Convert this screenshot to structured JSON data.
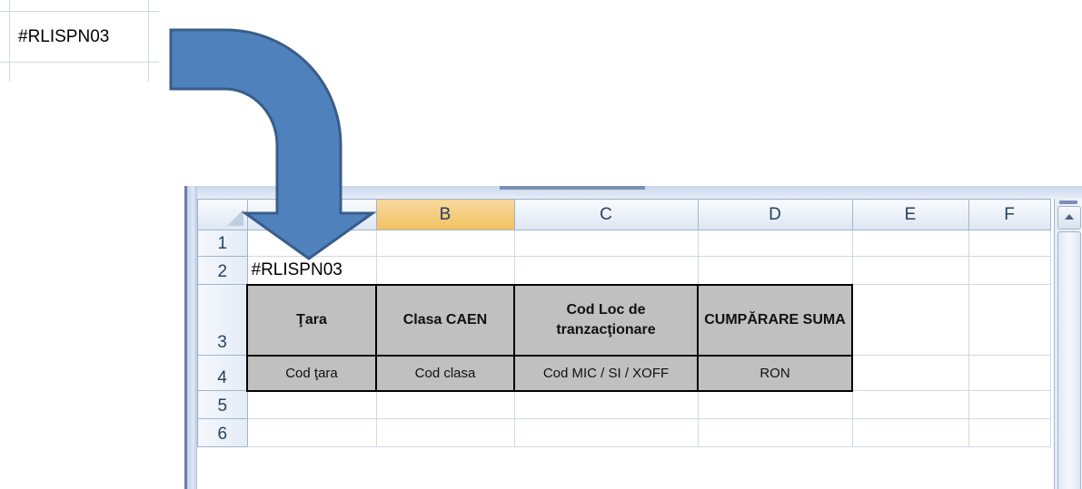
{
  "snippet": {
    "cell_text": "#RLISPN03"
  },
  "sheet": {
    "columns": [
      "",
      "B",
      "C",
      "D",
      "E",
      "F"
    ],
    "selected_column": "B",
    "rows": [
      "1",
      "2",
      "3",
      "4",
      "5",
      "6"
    ],
    "cell_a2": "#RLISPN03",
    "table": {
      "headers": [
        "Ţara",
        "Clasa CAEN",
        "Cod Loc de tranzacţionare",
        "CUMPĂRARE SUMA"
      ],
      "subheaders": [
        "Cod ţara",
        "Cod clasa",
        "Cod MIC / SI / XOFF",
        "RON"
      ]
    }
  },
  "colors": {
    "arrow_fill": "#4f81bd",
    "arrow_stroke": "#385d8a",
    "header_fill": "#c0c0c0",
    "selected_col": "#f1c15f"
  },
  "icons": {
    "corner": "select-all-triangle-icon",
    "scroll_up": "scroll-up-arrow-icon"
  }
}
